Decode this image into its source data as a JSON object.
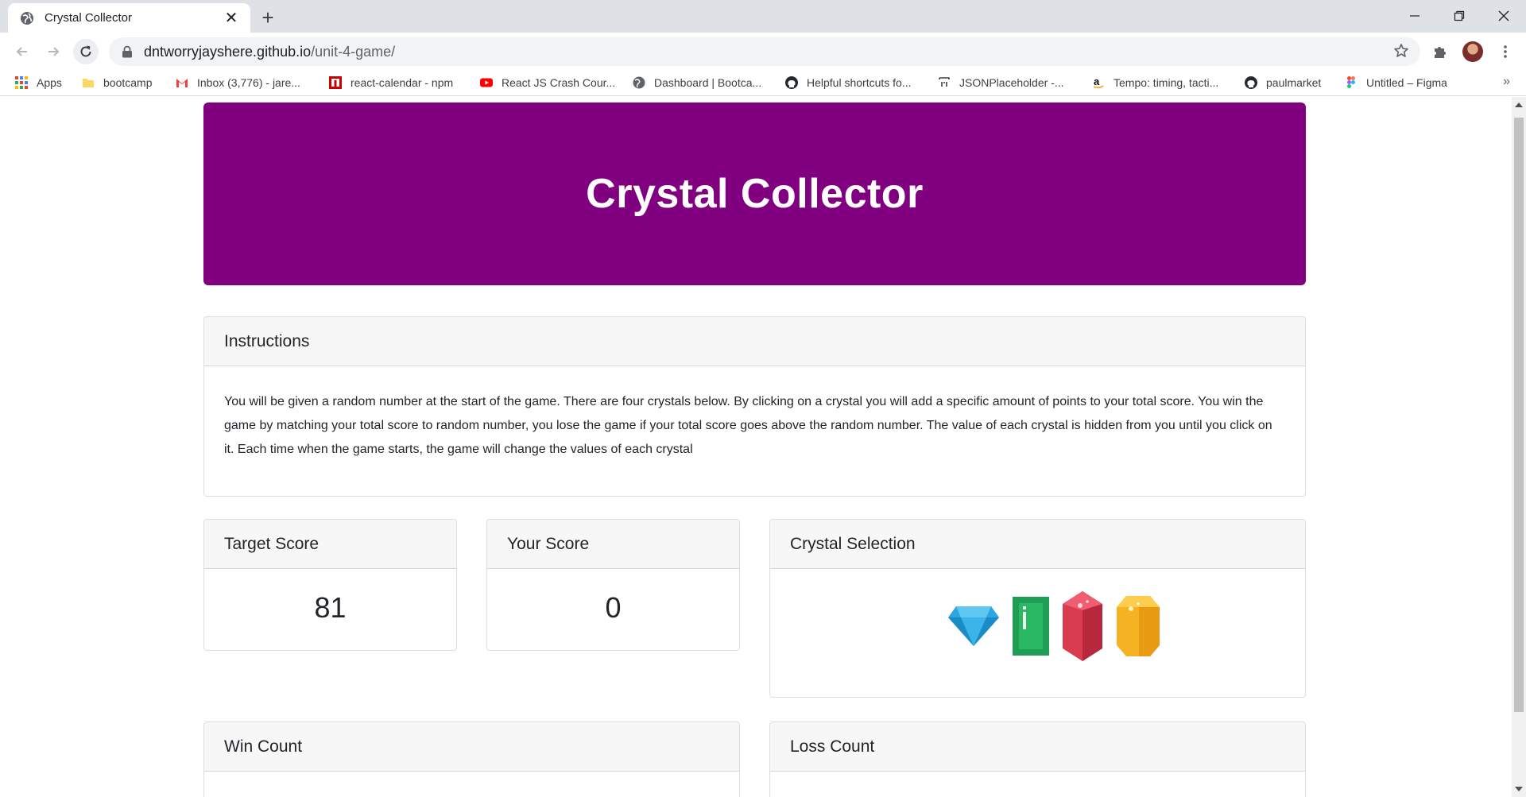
{
  "browser": {
    "tab_title": "Crystal Collector",
    "url_host": "dntworryjayshere.github.io",
    "url_path": "/unit-4-game/",
    "bookmarks": [
      {
        "label": "Apps",
        "icon": "apps-grid-icon"
      },
      {
        "label": "bootcamp",
        "icon": "folder-icon"
      },
      {
        "label": "Inbox (3,776) - jare...",
        "icon": "gmail-icon"
      },
      {
        "label": "react-calendar - npm",
        "icon": "npm-icon"
      },
      {
        "label": "React JS Crash Cour...",
        "icon": "youtube-icon"
      },
      {
        "label": "Dashboard | Bootca...",
        "icon": "globe-icon"
      },
      {
        "label": "Helpful shortcuts fo...",
        "icon": "github-icon"
      },
      {
        "label": "JSONPlaceholder -...",
        "icon": "jsonplaceholder-icon"
      },
      {
        "label": "Tempo: timing, tacti...",
        "icon": "amazon-icon"
      },
      {
        "label": "paulmarket",
        "icon": "github-icon"
      },
      {
        "label": "Untitled – Figma",
        "icon": "figma-icon"
      }
    ],
    "bookmarks_more": "»"
  },
  "game": {
    "title": "Crystal Collector",
    "instructions": {
      "header": "Instructions",
      "text": "You will be given a random number at the start of the game. There are four crystals below. By clicking on a crystal you will add a specific amount of points to your total score. You win the game by matching your total score to random number, you lose the game if your total score goes above the random number. The value of each crystal is hidden from you until you click on it. Each time when the game starts, the game will change the values of each crystal"
    },
    "target": {
      "header": "Target Score",
      "value": "81"
    },
    "your_score": {
      "header": "Your Score",
      "value": "0"
    },
    "crystal_selection": {
      "header": "Crystal Selection",
      "crystals": [
        "blue-diamond-icon",
        "green-emerald-icon",
        "red-ruby-icon",
        "yellow-topaz-icon"
      ]
    },
    "win": {
      "header": "Win Count"
    },
    "loss": {
      "header": "Loss Count"
    }
  },
  "colors": {
    "jumbotron": "#800080",
    "card_header": "#f7f7f7",
    "tabstrip": "#dee1e6"
  }
}
